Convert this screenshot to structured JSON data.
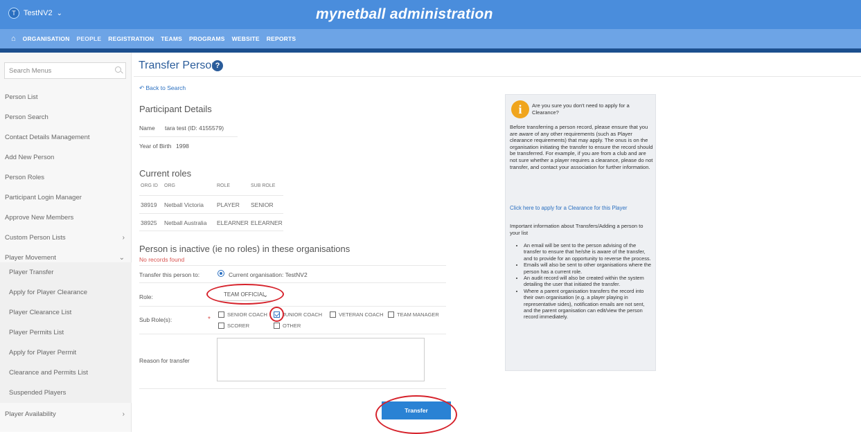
{
  "topbar": {
    "org_initial": "T",
    "org_name": "TestNV2",
    "app_title": "mynetball administration"
  },
  "nav": [
    "ORGANISATION",
    "PEOPLE",
    "REGISTRATION",
    "TEAMS",
    "PROGRAMS",
    "WEBSITE",
    "REPORTS"
  ],
  "sidebar": {
    "search_placeholder": "Search Menus",
    "items": [
      "Person List",
      "Person Search",
      "Contact Details Management",
      "Add New Person",
      "Person Roles",
      "Participant Login Manager",
      "Approve New Members",
      "Custom Person Lists",
      "Player Movement",
      "Player Transfer",
      "Apply for Player Clearance",
      "Player Clearance List",
      "Player Permits List",
      "Apply for Player Permit",
      "Clearance and Permits List",
      "Suspended Players",
      "Player Availability"
    ]
  },
  "page": {
    "title": "Transfer Person",
    "back_link": "Back to Search",
    "participant_heading": "Participant Details",
    "name_label": "Name",
    "name_value": "tara test (ID: 4155579)",
    "yob_label": "Year of Birth",
    "yob_value": "1998",
    "roles_heading": "Current roles",
    "roles_headers": [
      "ORG ID",
      "ORG",
      "ROLE",
      "SUB ROLE"
    ],
    "roles": [
      [
        "38919",
        "Netball Victoria",
        "PLAYER",
        "SENIOR"
      ],
      [
        "38925",
        "Netball Australia",
        "ELEARNER",
        "ELEARNER"
      ]
    ],
    "inactive_heading": "Person is inactive (ie no roles) in these organisations",
    "no_records": "No records found",
    "transfer_to_label": "Transfer this person to:",
    "transfer_to_value": "Current organisation: TestNV2",
    "role_label": "Role:",
    "role_value": "TEAM OFFICIAL",
    "subrole_label": "Sub Role(s):",
    "subroles": [
      "SENIOR COACH",
      "JUNIOR COACH",
      "VETERAN COACH",
      "TEAM MANAGER",
      "SCORER",
      "OTHER"
    ],
    "reason_label": "Reason for transfer",
    "transfer_button": "Transfer"
  },
  "info": {
    "question": "Are you sure you don't need to apply for a Clearance?",
    "paragraph": "Before transferring a person record, please ensure that you are aware of any other requirements (such as Player clearance requirements) that may apply. The onus is on the organisation initiating the transfer to ensure the record should be transferred. For example, if you are from a club and are not sure whether a player requires a clearance, please do not transfer, and contact your association for further information.",
    "link": "Click here to apply for a Clearance for this Player",
    "important": "Important information about Transfers/Adding a person to your list",
    "bullets": [
      "An email will be sent to the person advising of the transfer to ensure that he/she is aware of the transfer, and to provide for an opportunity to reverse the process.",
      "Emails will also be sent to other organisations where the person has a current role.",
      "An audit record will also be created within the system detailing the user that initiated the transfer.",
      "Where a parent organisation transfers the record into their own organisation (e.g. a player playing in representative sides), notification emails are not sent, and the parent organisation can edit/view the person record immediately."
    ]
  }
}
